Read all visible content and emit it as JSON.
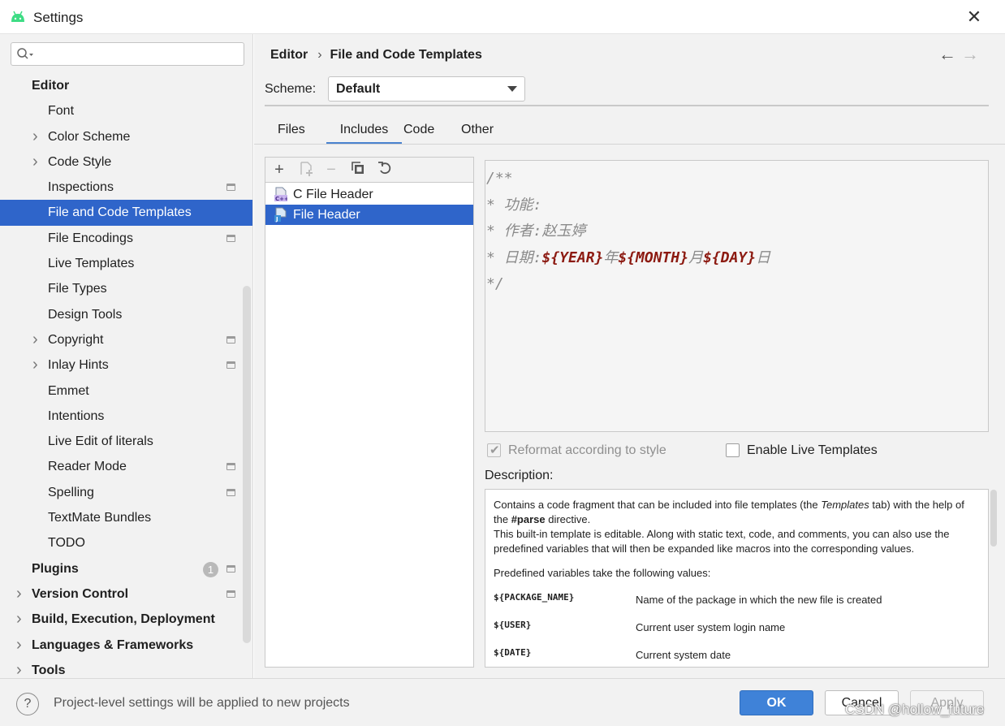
{
  "window": {
    "title": "Settings"
  },
  "sidebar": {
    "search_placeholder": "",
    "items": [
      {
        "label": "Editor",
        "level": "top",
        "chevron": false,
        "project": false
      },
      {
        "label": "Font",
        "level": "sub",
        "chevron": false,
        "project": false
      },
      {
        "label": "Color Scheme",
        "level": "sub",
        "chevron": true,
        "project": false
      },
      {
        "label": "Code Style",
        "level": "sub",
        "chevron": true,
        "project": false
      },
      {
        "label": "Inspections",
        "level": "sub",
        "chevron": false,
        "project": true
      },
      {
        "label": "File and Code Templates",
        "level": "sub",
        "chevron": false,
        "project": false,
        "selected": true
      },
      {
        "label": "File Encodings",
        "level": "sub",
        "chevron": false,
        "project": true
      },
      {
        "label": "Live Templates",
        "level": "sub",
        "chevron": false,
        "project": false
      },
      {
        "label": "File Types",
        "level": "sub",
        "chevron": false,
        "project": false
      },
      {
        "label": "Design Tools",
        "level": "sub",
        "chevron": false,
        "project": false
      },
      {
        "label": "Copyright",
        "level": "sub",
        "chevron": true,
        "project": true
      },
      {
        "label": "Inlay Hints",
        "level": "sub",
        "chevron": true,
        "project": true
      },
      {
        "label": "Emmet",
        "level": "sub",
        "chevron": false,
        "project": false
      },
      {
        "label": "Intentions",
        "level": "sub",
        "chevron": false,
        "project": false
      },
      {
        "label": "Live Edit of literals",
        "level": "sub",
        "chevron": false,
        "project": false
      },
      {
        "label": "Reader Mode",
        "level": "sub",
        "chevron": false,
        "project": true
      },
      {
        "label": "Spelling",
        "level": "sub",
        "chevron": false,
        "project": true
      },
      {
        "label": "TextMate Bundles",
        "level": "sub",
        "chevron": false,
        "project": false
      },
      {
        "label": "TODO",
        "level": "sub",
        "chevron": false,
        "project": false
      },
      {
        "label": "Plugins",
        "level": "top",
        "chevron": false,
        "project": true,
        "badge": "1"
      },
      {
        "label": "Version Control",
        "level": "top",
        "chevron": true,
        "project": true
      },
      {
        "label": "Build, Execution, Deployment",
        "level": "top",
        "chevron": true,
        "project": false
      },
      {
        "label": "Languages & Frameworks",
        "level": "top",
        "chevron": true,
        "project": false
      },
      {
        "label": "Tools",
        "level": "top",
        "chevron": true,
        "project": false
      }
    ]
  },
  "header": {
    "breadcrumb_parent": "Editor",
    "breadcrumb_separator": "›",
    "breadcrumb_current": "File and Code Templates"
  },
  "scheme": {
    "label": "Scheme:",
    "value": "Default"
  },
  "tabs": [
    "Files",
    "Includes",
    "Code",
    "Other"
  ],
  "active_tab": "Includes",
  "templates": [
    {
      "name": "C File Header",
      "icon": "c-file-icon",
      "selected": false
    },
    {
      "name": "File Header",
      "icon": "java-file-icon",
      "selected": true
    }
  ],
  "editor": {
    "lines": [
      [
        {
          "t": "/**"
        }
      ],
      [
        {
          "t": "* 功能:"
        }
      ],
      [
        {
          "t": "* 作者:赵玉婷"
        }
      ],
      [
        {
          "t": "* 日期:"
        },
        {
          "t": "${YEAR}",
          "var": true
        },
        {
          "t": "年"
        },
        {
          "t": "${MONTH}",
          "var": true
        },
        {
          "t": "月"
        },
        {
          "t": "${DAY}",
          "var": true
        },
        {
          "t": "日"
        }
      ],
      [
        {
          "t": "*/"
        }
      ]
    ]
  },
  "options": {
    "reformat_label": "Reformat according to style",
    "reformat_checked": true,
    "live_templates_label": "Enable Live Templates",
    "live_templates_checked": false
  },
  "description": {
    "label": "Description:",
    "p1_a": "Contains a code fragment that can be included into file templates (the ",
    "p1_em": "Templates",
    "p1_b": " tab) with the help of the ",
    "p1_strong": "#parse",
    "p1_c": " directive.",
    "p1_d": "This built-in template is editable. Along with static text, code, and comments, you can also use the predefined variables that will then be expanded like macros into the corresponding values.",
    "p2": "Predefined variables take the following values:",
    "vars": [
      {
        "name": "${PACKAGE_NAME}",
        "desc": "Name of the package in which the new file is created"
      },
      {
        "name": "${USER}",
        "desc": "Current user system login name"
      },
      {
        "name": "${DATE}",
        "desc": "Current system date"
      }
    ]
  },
  "footer": {
    "note": "Project-level settings will be applied to new projects",
    "ok": "OK",
    "cancel": "Cancel",
    "apply": "Apply",
    "watermark": "CSDN @hollow_future"
  },
  "colors": {
    "selection": "#2f65ca",
    "ok_button": "#3f82d8",
    "variable": "#8c1a11"
  }
}
